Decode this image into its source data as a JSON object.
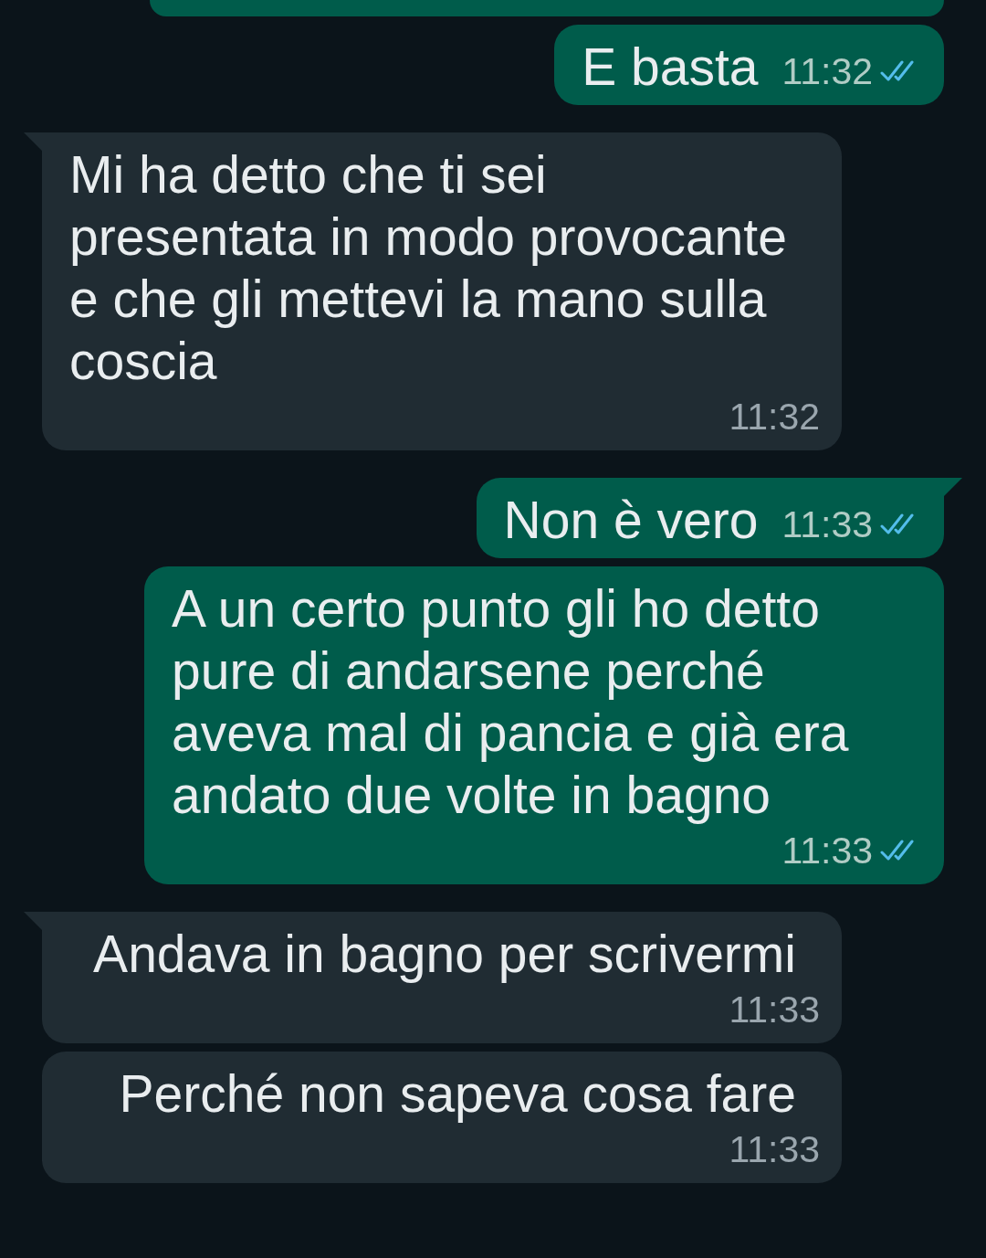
{
  "messages": [
    {
      "kind": "outgoing",
      "cut_off": true
    },
    {
      "kind": "outgoing",
      "tail": false,
      "text": "E basta",
      "time": "11:32",
      "read": true
    },
    {
      "kind": "incoming",
      "tail": true,
      "text": "Mi ha detto che ti sei presentata in modo provocante e che gli mettevi la mano sulla coscia",
      "time": "11:32"
    },
    {
      "kind": "outgoing",
      "tail": true,
      "text": "Non è vero",
      "time": "11:33",
      "read": true
    },
    {
      "kind": "outgoing",
      "tail": false,
      "text": "A un certo punto gli ho detto pure di andarsene perché aveva mal di pancia e già era andato due volte in bagno",
      "time": "11:33",
      "read": true
    },
    {
      "kind": "incoming",
      "tail": true,
      "text": "Andava in bagno per scrivermi",
      "time": "11:33"
    },
    {
      "kind": "incoming",
      "tail": false,
      "text": "Perché non sapeva cosa fare",
      "time": "11:33"
    }
  ]
}
